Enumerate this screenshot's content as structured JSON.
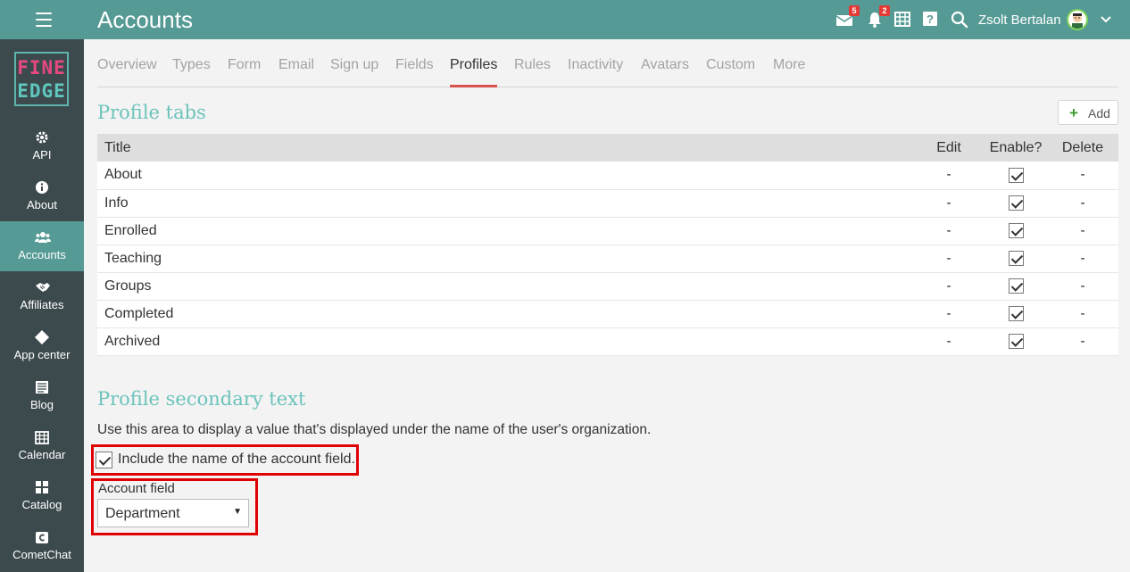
{
  "header": {
    "title": "Accounts",
    "messages_badge": "5",
    "notifications_badge": "2",
    "user_name": "Zsolt Bertalan"
  },
  "logo": {
    "line1": "FINE",
    "line2": "EDGE"
  },
  "sidebar": {
    "items": [
      {
        "label": "API",
        "icon": "gear-icon"
      },
      {
        "label": "About",
        "icon": "info-icon"
      },
      {
        "label": "Accounts",
        "icon": "users-icon",
        "active": true
      },
      {
        "label": "Affiliates",
        "icon": "handshake-icon"
      },
      {
        "label": "App center",
        "icon": "diamonds-icon"
      },
      {
        "label": "Blog",
        "icon": "blog-icon"
      },
      {
        "label": "Calendar",
        "icon": "calendar-icon"
      },
      {
        "label": "Catalog",
        "icon": "grid-icon"
      },
      {
        "label": "CometChat",
        "icon": "cometchat-icon"
      }
    ]
  },
  "tabs": [
    "Overview",
    "Types",
    "Form",
    "Email",
    "Sign up",
    "Fields",
    "Profiles",
    "Rules",
    "Inactivity",
    "Avatars",
    "Custom",
    "More"
  ],
  "active_tab": "Profiles",
  "profile_tabs": {
    "title": "Profile tabs",
    "add_label": "Add",
    "columns": {
      "title": "Title",
      "edit": "Edit",
      "enable": "Enable?",
      "delete": "Delete"
    },
    "rows": [
      {
        "title": "About",
        "edit": "-",
        "enabled": true,
        "delete": "-"
      },
      {
        "title": "Info",
        "edit": "-",
        "enabled": true,
        "delete": "-"
      },
      {
        "title": "Enrolled",
        "edit": "-",
        "enabled": true,
        "delete": "-"
      },
      {
        "title": "Teaching",
        "edit": "-",
        "enabled": true,
        "delete": "-"
      },
      {
        "title": "Groups",
        "edit": "-",
        "enabled": true,
        "delete": "-"
      },
      {
        "title": "Completed",
        "edit": "-",
        "enabled": true,
        "delete": "-"
      },
      {
        "title": "Archived",
        "edit": "-",
        "enabled": true,
        "delete": "-"
      }
    ]
  },
  "secondary": {
    "title": "Profile secondary text",
    "description": "Use this area to display a value that's displayed under the name of the user's organization.",
    "include_label": "Include the name of the account field.",
    "include_checked": true,
    "field_label": "Account field",
    "field_value": "Department"
  },
  "colors": {
    "topbar": "#559a94",
    "sidebar": "#3c4a4e",
    "accent": "#6cc3bb",
    "highlight": "#e00000"
  }
}
